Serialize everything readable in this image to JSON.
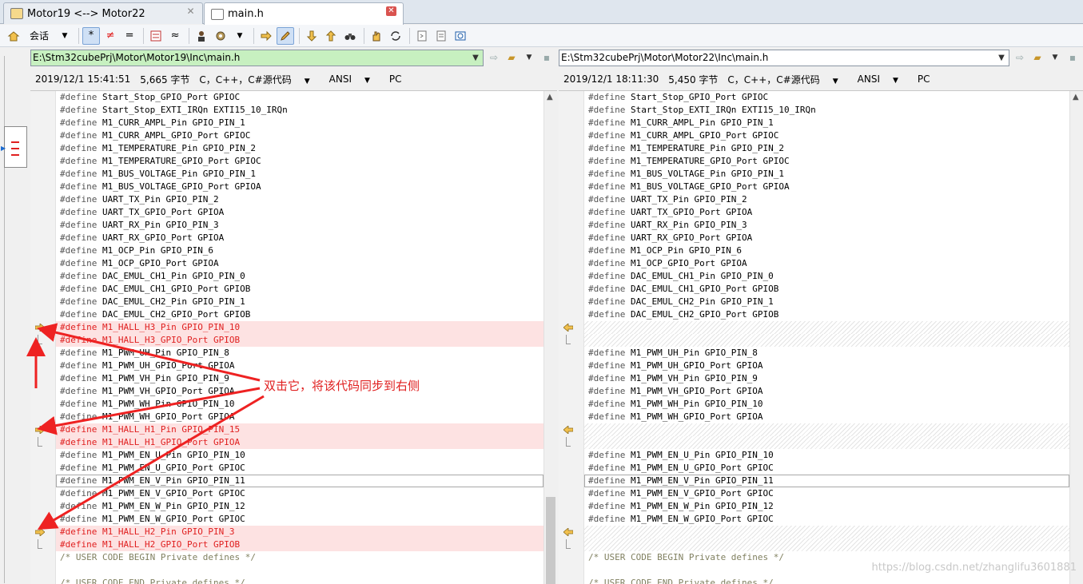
{
  "tabs": [
    {
      "label": "Motor19 <--> Motor22",
      "active": false
    },
    {
      "label": "main.h",
      "active": true
    }
  ],
  "toolbar": {
    "session_label": "会话",
    "icons": [
      "home-icon",
      "asterisk-icon",
      "not-equal-icon",
      "equal-icon",
      "diff-rules-icon",
      "approx-icon",
      "person-icon",
      "gear-icon",
      "arrow-right-icon",
      "pencil-icon",
      "arrow-down-icon",
      "arrow-up-icon",
      "binoculars-icon",
      "hand-icon",
      "sync-icon",
      "doc-icon",
      "doc2-icon",
      "web-icon"
    ],
    "glyphs": {
      "asterisk": "*",
      "not_equal": "≠",
      "equal": "=",
      "approx": "≈"
    }
  },
  "left": {
    "path": "E:\\Stm32cubePrj\\Motor\\Motor19\\Inc\\main.h",
    "date": "2019/12/1 15:41:51",
    "size": "5,665 字节",
    "lang": "C，C++，C#源代码",
    "encoding": "ANSI",
    "eol": "PC"
  },
  "right": {
    "path": "E:\\Stm32cubePrj\\Motor\\Motor22\\Inc\\main.h",
    "date": "2019/12/1 18:11:30",
    "size": "5,450 字节",
    "lang": "C，C++，C#源代码",
    "encoding": "ANSI",
    "eol": "PC"
  },
  "left_lines": [
    {
      "t": "#define Start_Stop_GPIO_Port GPIOC",
      "k": "n"
    },
    {
      "t": "#define Start_Stop_EXTI_IRQn EXTI15_10_IRQn",
      "k": "n"
    },
    {
      "t": "#define M1_CURR_AMPL_Pin GPIO_PIN_1",
      "k": "n"
    },
    {
      "t": "#define M1_CURR_AMPL_GPIO_Port GPIOC",
      "k": "n"
    },
    {
      "t": "#define M1_TEMPERATURE_Pin GPIO_PIN_2",
      "k": "n"
    },
    {
      "t": "#define M1_TEMPERATURE_GPIO_Port GPIOC",
      "k": "n"
    },
    {
      "t": "#define M1_BUS_VOLTAGE_Pin GPIO_PIN_1",
      "k": "n"
    },
    {
      "t": "#define M1_BUS_VOLTAGE_GPIO_Port GPIOA",
      "k": "n"
    },
    {
      "t": "#define UART_TX_Pin GPIO_PIN_2",
      "k": "n"
    },
    {
      "t": "#define UART_TX_GPIO_Port GPIOA",
      "k": "n"
    },
    {
      "t": "#define UART_RX_Pin GPIO_PIN_3",
      "k": "n"
    },
    {
      "t": "#define UART_RX_GPIO_Port GPIOA",
      "k": "n"
    },
    {
      "t": "#define M1_OCP_Pin GPIO_PIN_6",
      "k": "n"
    },
    {
      "t": "#define M1_OCP_GPIO_Port GPIOA",
      "k": "n"
    },
    {
      "t": "#define DAC_EMUL_CH1_Pin GPIO_PIN_0",
      "k": "n"
    },
    {
      "t": "#define DAC_EMUL_CH1_GPIO_Port GPIOB",
      "k": "n"
    },
    {
      "t": "#define DAC_EMUL_CH2_Pin GPIO_PIN_1",
      "k": "n"
    },
    {
      "t": "#define DAC_EMUL_CH2_GPIO_Port GPIOB",
      "k": "n"
    },
    {
      "t": "#define M1_HALL_H3_Pin GPIO_PIN_10",
      "k": "d",
      "g": "arrow"
    },
    {
      "t": "#define M1_HALL_H3_GPIO_Port GPIOB",
      "k": "d",
      "g": "bracket"
    },
    {
      "t": "#define M1_PWM_UH_Pin GPIO_PIN_8",
      "k": "n"
    },
    {
      "t": "#define M1_PWM_UH_GPIO_Port GPIOA",
      "k": "n"
    },
    {
      "t": "#define M1_PWM_VH_Pin GPIO_PIN_9",
      "k": "n"
    },
    {
      "t": "#define M1_PWM_VH_GPIO_Port GPIOA",
      "k": "n"
    },
    {
      "t": "#define M1_PWM_WH_Pin GPIO_PIN_10",
      "k": "n"
    },
    {
      "t": "#define M1_PWM_WH_GPIO_Port GPIOA",
      "k": "n"
    },
    {
      "t": "#define M1_HALL_H1_Pin GPIO_PIN_15",
      "k": "d",
      "g": "arrow"
    },
    {
      "t": "#define M1_HALL_H1_GPIO_Port GPIOA",
      "k": "d",
      "g": "bracket"
    },
    {
      "t": "#define M1_PWM_EN_U_Pin GPIO_PIN_10",
      "k": "n"
    },
    {
      "t": "#define M1_PWM_EN_U_GPIO_Port GPIOC",
      "k": "n"
    },
    {
      "t": "#define M1_PWM_EN_V_Pin GPIO_PIN_11",
      "k": "f"
    },
    {
      "t": "#define M1_PWM_EN_V_GPIO_Port GPIOC",
      "k": "n"
    },
    {
      "t": "#define M1_PWM_EN_W_Pin GPIO_PIN_12",
      "k": "n"
    },
    {
      "t": "#define M1_PWM_EN_W_GPIO_Port GPIOC",
      "k": "n"
    },
    {
      "t": "#define M1_HALL_H2_Pin GPIO_PIN_3",
      "k": "d",
      "g": "arrow"
    },
    {
      "t": "#define M1_HALL_H2_GPIO_Port GPIOB",
      "k": "d",
      "g": "bracket"
    },
    {
      "t": "/* USER CODE BEGIN Private defines */",
      "k": "c"
    },
    {
      "t": "",
      "k": "n"
    },
    {
      "t": "/* USER CODE END Private defines */",
      "k": "c"
    }
  ],
  "right_lines": [
    {
      "t": "#define Start_Stop_GPIO_Port GPIOC",
      "k": "n"
    },
    {
      "t": "#define Start_Stop_EXTI_IRQn EXTI15_10_IRQn",
      "k": "n"
    },
    {
      "t": "#define M1_CURR_AMPL_Pin GPIO_PIN_1",
      "k": "n"
    },
    {
      "t": "#define M1_CURR_AMPL_GPIO_Port GPIOC",
      "k": "n"
    },
    {
      "t": "#define M1_TEMPERATURE_Pin GPIO_PIN_2",
      "k": "n"
    },
    {
      "t": "#define M1_TEMPERATURE_GPIO_Port GPIOC",
      "k": "n"
    },
    {
      "t": "#define M1_BUS_VOLTAGE_Pin GPIO_PIN_1",
      "k": "n"
    },
    {
      "t": "#define M1_BUS_VOLTAGE_GPIO_Port GPIOA",
      "k": "n"
    },
    {
      "t": "#define UART_TX_Pin GPIO_PIN_2",
      "k": "n"
    },
    {
      "t": "#define UART_TX_GPIO_Port GPIOA",
      "k": "n"
    },
    {
      "t": "#define UART_RX_Pin GPIO_PIN_3",
      "k": "n"
    },
    {
      "t": "#define UART_RX_GPIO_Port GPIOA",
      "k": "n"
    },
    {
      "t": "#define M1_OCP_Pin GPIO_PIN_6",
      "k": "n"
    },
    {
      "t": "#define M1_OCP_GPIO_Port GPIOA",
      "k": "n"
    },
    {
      "t": "#define DAC_EMUL_CH1_Pin GPIO_PIN_0",
      "k": "n"
    },
    {
      "t": "#define DAC_EMUL_CH1_GPIO_Port GPIOB",
      "k": "n"
    },
    {
      "t": "#define DAC_EMUL_CH2_Pin GPIO_PIN_1",
      "k": "n"
    },
    {
      "t": "#define DAC_EMUL_CH2_GPIO_Port GPIOB",
      "k": "n"
    },
    {
      "t": "",
      "k": "g",
      "g": "arrow"
    },
    {
      "t": "",
      "k": "g",
      "g": "bracket"
    },
    {
      "t": "#define M1_PWM_UH_Pin GPIO_PIN_8",
      "k": "n"
    },
    {
      "t": "#define M1_PWM_UH_GPIO_Port GPIOA",
      "k": "n"
    },
    {
      "t": "#define M1_PWM_VH_Pin GPIO_PIN_9",
      "k": "n"
    },
    {
      "t": "#define M1_PWM_VH_GPIO_Port GPIOA",
      "k": "n"
    },
    {
      "t": "#define M1_PWM_WH_Pin GPIO_PIN_10",
      "k": "n"
    },
    {
      "t": "#define M1_PWM_WH_GPIO_Port GPIOA",
      "k": "n"
    },
    {
      "t": "",
      "k": "g",
      "g": "arrow"
    },
    {
      "t": "",
      "k": "g",
      "g": "bracket"
    },
    {
      "t": "#define M1_PWM_EN_U_Pin GPIO_PIN_10",
      "k": "n"
    },
    {
      "t": "#define M1_PWM_EN_U_GPIO_Port GPIOC",
      "k": "n"
    },
    {
      "t": "#define M1_PWM_EN_V_Pin GPIO_PIN_11",
      "k": "f"
    },
    {
      "t": "#define M1_PWM_EN_V_GPIO_Port GPIOC",
      "k": "n"
    },
    {
      "t": "#define M1_PWM_EN_W_Pin GPIO_PIN_12",
      "k": "n"
    },
    {
      "t": "#define M1_PWM_EN_W_GPIO_Port GPIOC",
      "k": "n"
    },
    {
      "t": "",
      "k": "g",
      "g": "arrow"
    },
    {
      "t": "",
      "k": "g",
      "g": "bracket"
    },
    {
      "t": "/* USER CODE BEGIN Private defines */",
      "k": "c"
    },
    {
      "t": "",
      "k": "n"
    },
    {
      "t": "/* USER CODE END Private defines */",
      "k": "c"
    }
  ],
  "annotation": "双击它，将该代码同步到右侧",
  "watermark": "https://blog.csdn.net/zhanglifu3601881",
  "colors": {
    "diff_bg": "#fde2e2",
    "diff_text": "#e02020",
    "annotation": "#e02020",
    "path_match_bg": "#c7f0c0"
  }
}
